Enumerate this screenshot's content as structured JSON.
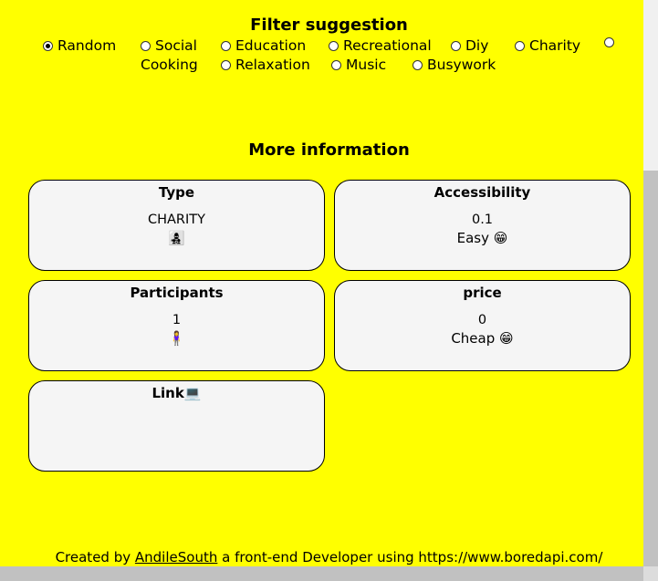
{
  "filter": {
    "title": "Filter suggestion",
    "options": [
      "Random",
      "Social",
      "Education",
      "Recreational",
      "Diy",
      "Charity",
      "Cooking",
      "Relaxation",
      "Music",
      "Busywork"
    ],
    "selected": "Random"
  },
  "more": {
    "title": "More information",
    "type": {
      "title": "Type",
      "value": "CHARITY",
      "emoji": "👩‍👧‍👦"
    },
    "accessibility": {
      "title": "Accessibility",
      "value": "0.1",
      "label": "Easy 😁"
    },
    "participants": {
      "title": "Participants",
      "value": "1",
      "emoji": "🧍‍♀️"
    },
    "price": {
      "title": "price",
      "value": "0",
      "label": "Cheap 😁"
    },
    "link": {
      "title": "Link💻"
    }
  },
  "footer": {
    "prefix": "Created by",
    "author": "AndileSouth",
    "suffix": "a front-end Developer using https://www.boredapi.com/"
  }
}
